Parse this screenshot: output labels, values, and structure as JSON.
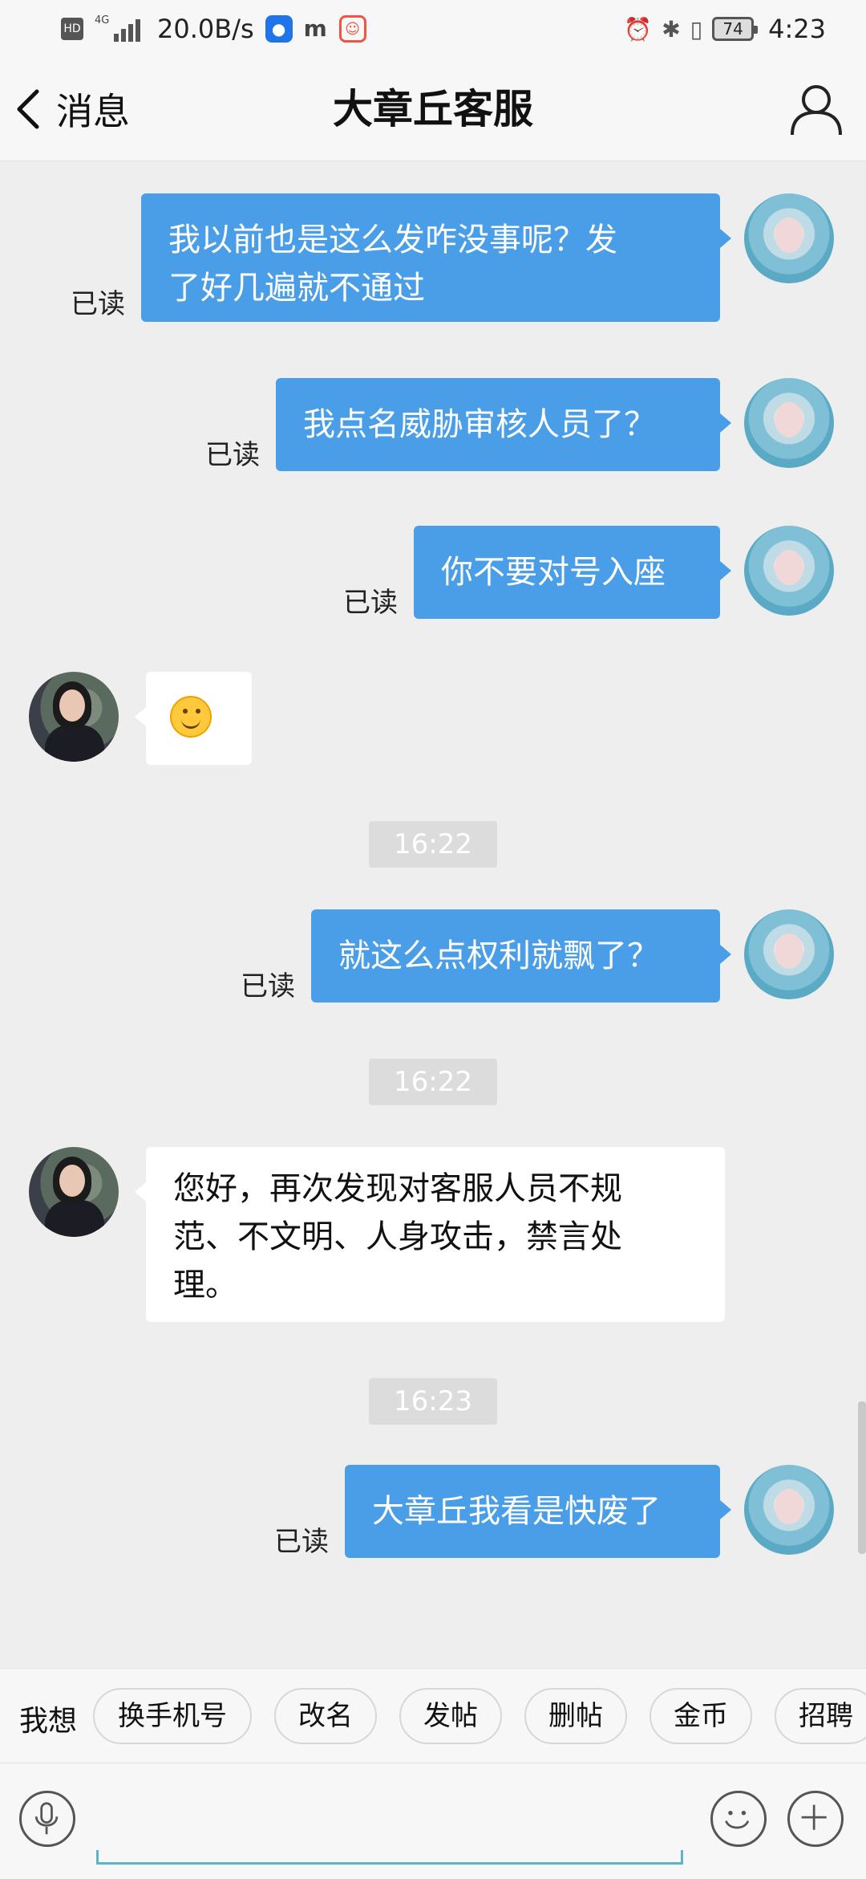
{
  "status_bar": {
    "hd": "HD",
    "network": "4G",
    "speed": "20.0B/s",
    "battery": "74",
    "time": "4:23"
  },
  "header": {
    "back_label": "消息",
    "title": "大章丘客服"
  },
  "messages": [
    {
      "sender": "me",
      "lines": [
        "我以前也是这么发咋没事呢？发",
        "了好几遍就不通过"
      ],
      "status": "已读"
    },
    {
      "sender": "me",
      "lines": [
        "我点名威胁审核人员了？"
      ],
      "status": "已读"
    },
    {
      "sender": "me",
      "lines": [
        "你不要对号入座"
      ],
      "status": "已读"
    },
    {
      "sender": "agent",
      "content": "smiley-emoji"
    },
    {
      "time": "16:22"
    },
    {
      "sender": "me",
      "lines": [
        "就这么点权利就飘了？"
      ],
      "status": "已读"
    },
    {
      "time": "16:22"
    },
    {
      "sender": "agent",
      "lines": [
        "您好，再次发现对客服人员不规",
        "范、不文明、人身攻击，禁言处",
        "理。"
      ]
    },
    {
      "time": "16:23"
    },
    {
      "sender": "me",
      "lines": [
        "大章丘我看是快废了"
      ],
      "status": "已读"
    }
  ],
  "quick_bar": {
    "label": "我想",
    "chips": [
      "换手机号",
      "改名",
      "发帖",
      "删帖",
      "金币",
      "招聘"
    ]
  },
  "icons": {
    "back": "chevron-left-icon",
    "profile": "person-icon",
    "voice": "microphone-icon",
    "emoji": "smiley-icon",
    "more": "plus-icon"
  },
  "colors": {
    "my_bubble": "#4a9ee8",
    "agent_bubble": "#ffffff",
    "background": "#eeeeee"
  }
}
